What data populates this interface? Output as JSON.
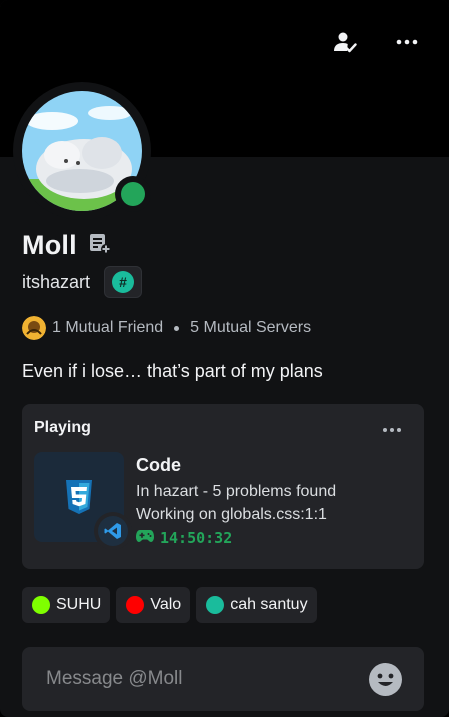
{
  "profile": {
    "display_name": "Moll",
    "username": "itshazart",
    "tag_symbol": "#",
    "status": "online",
    "status_color": "#23a55a",
    "bio": "Even if i lose… that’s part of my plans"
  },
  "banner": {
    "actions": [
      {
        "icon": "add-friend-check-icon"
      },
      {
        "icon": "more-horizontal-icon"
      }
    ]
  },
  "mutuals": {
    "friends": "1 Mutual Friend",
    "servers": "5 Mutual Servers"
  },
  "activity": {
    "header": "Playing",
    "app_name": "Code",
    "details": "In hazart - 5 problems found",
    "state": "Working on globals.css:1:1",
    "elapsed": "14:50:32",
    "elapsed_color": "#23a55a"
  },
  "roles": [
    {
      "name": "SUHU",
      "color": "#7fff00"
    },
    {
      "name": "Valo",
      "color": "#ff0000"
    },
    {
      "name": "cah santuy",
      "color": "#1abc9c"
    }
  ],
  "message": {
    "placeholder": "Message @Moll"
  },
  "colors": {
    "background": "#111214",
    "banner": "#000000",
    "surface": "#232428"
  }
}
